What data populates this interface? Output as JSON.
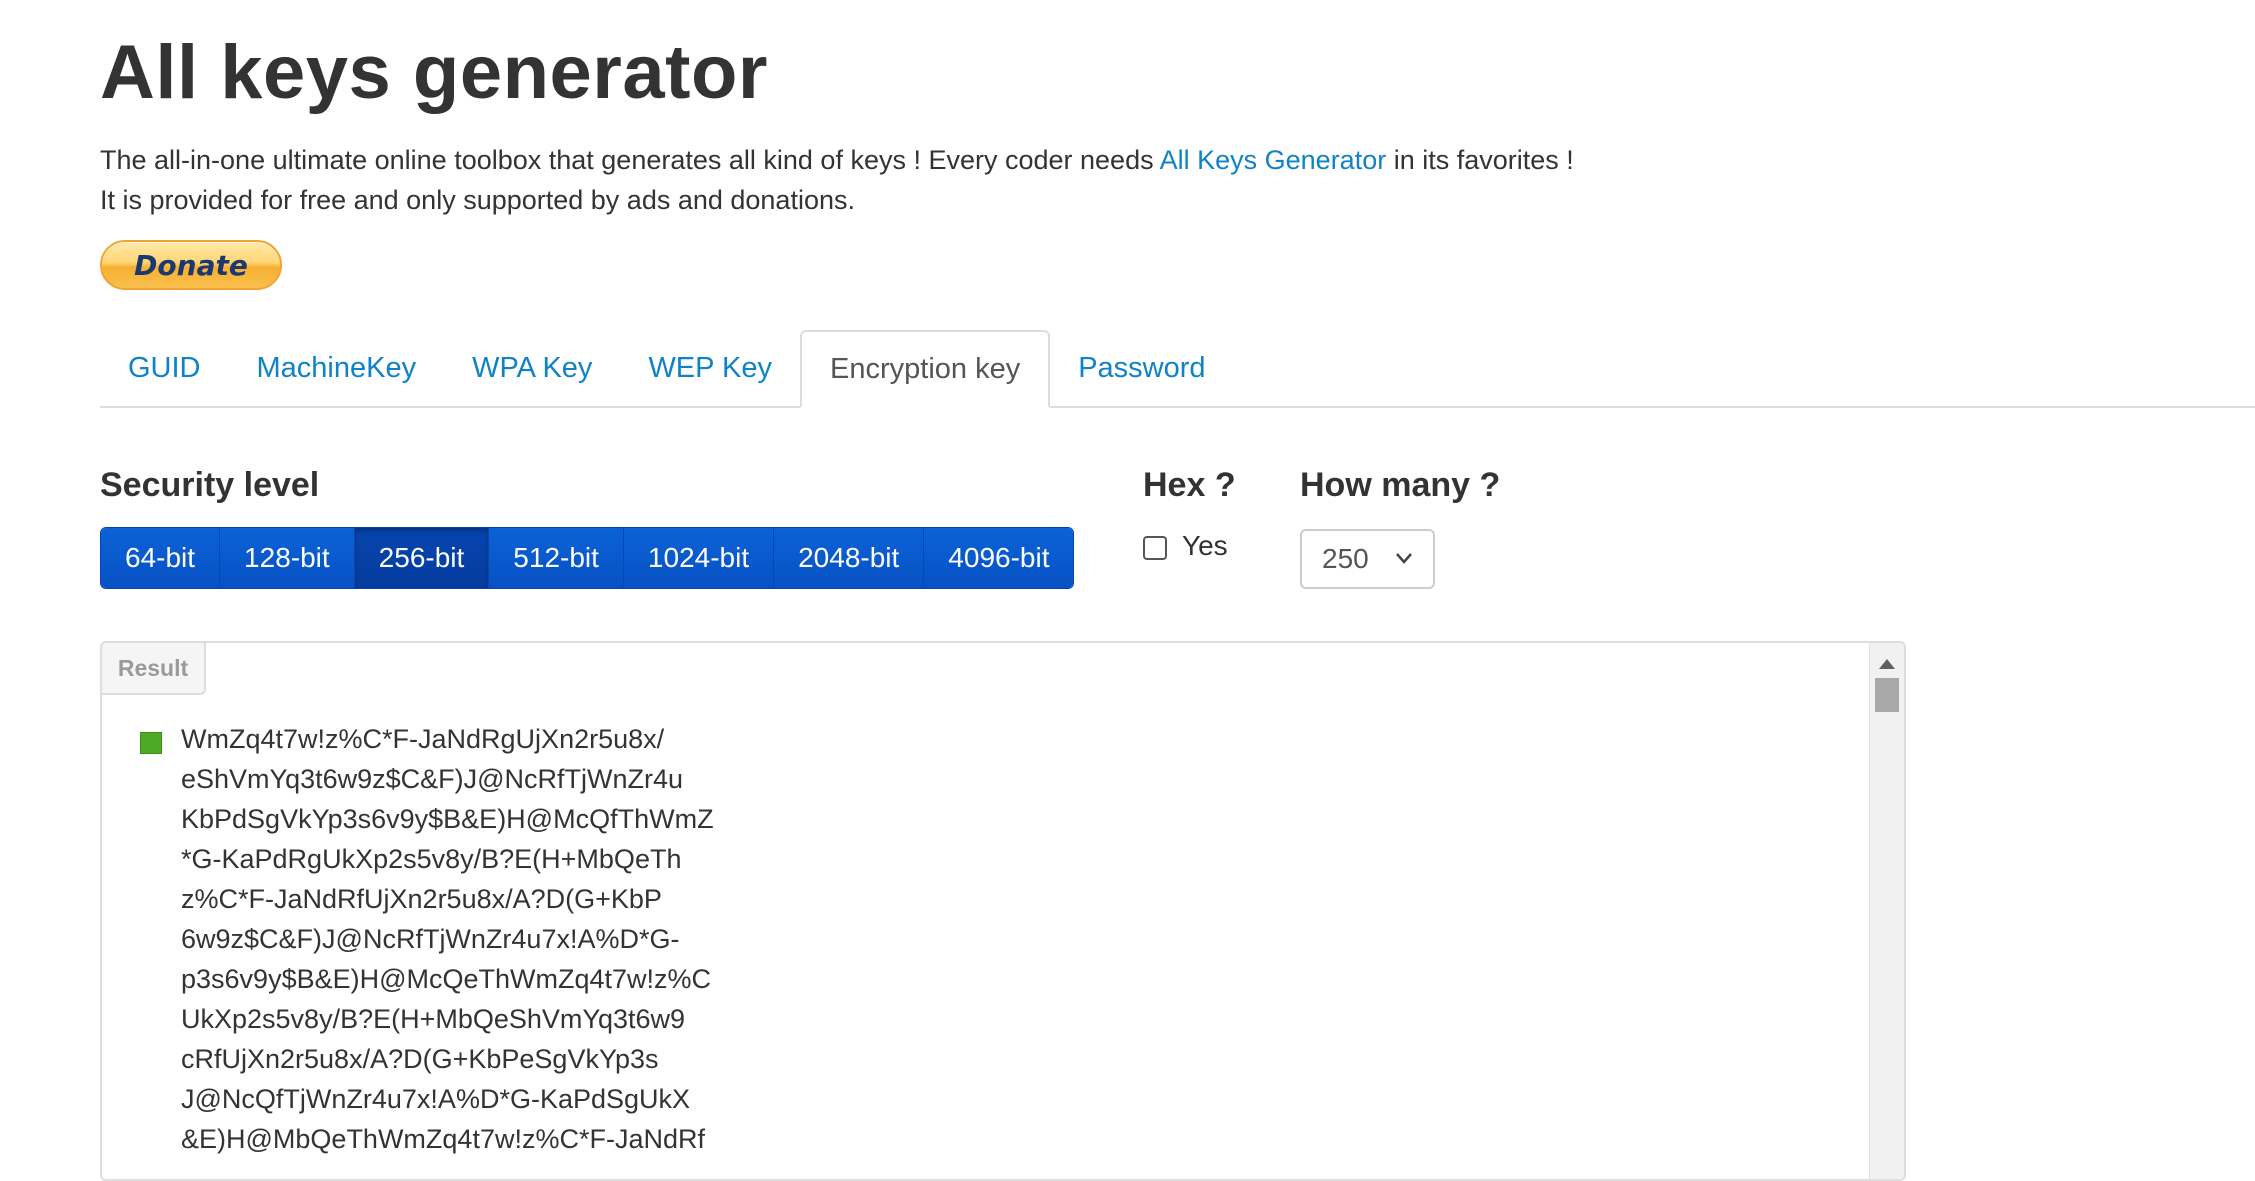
{
  "header": {
    "title": "All keys generator",
    "intro_before_link": "The all-in-one ultimate online toolbox that generates all kind of keys ! Every coder needs ",
    "intro_link": "All Keys Generator",
    "intro_after_link": " in its favorites !",
    "intro_line2": "It is provided for free and only supported by ads and donations.",
    "donate_label": "Donate"
  },
  "tabs": [
    {
      "label": "GUID",
      "active": false
    },
    {
      "label": "MachineKey",
      "active": false
    },
    {
      "label": "WPA Key",
      "active": false
    },
    {
      "label": "WEP Key",
      "active": false
    },
    {
      "label": "Encryption key",
      "active": true
    },
    {
      "label": "Password",
      "active": false
    }
  ],
  "security": {
    "label": "Security level",
    "options": [
      "64-bit",
      "128-bit",
      "256-bit",
      "512-bit",
      "1024-bit",
      "2048-bit",
      "4096-bit"
    ],
    "selected": "256-bit"
  },
  "hex": {
    "label": "Hex ?",
    "checkbox_label": "Yes",
    "checked": false
  },
  "how_many": {
    "label": "How many ?",
    "value": "250"
  },
  "result": {
    "tag": "Result",
    "bullet_color": "#4caa24",
    "key_lines": [
      "WmZq4t7w!z%C*F-JaNdRgUjXn2r5u8x/",
      "eShVmYq3t6w9z$C&F)J@NcRfTjWnZr4u",
      "KbPdSgVkYp3s6v9y$B&E)H@McQfThWmZ",
      "*G-KaPdRgUkXp2s5v8y/B?E(H+MbQeTh",
      "z%C*F-JaNdRfUjXn2r5u8x/A?D(G+KbP",
      "6w9z$C&F)J@NcRfTjWnZr4u7x!A%D*G-",
      "p3s6v9y$B&E)H@McQeThWmZq4t7w!z%C",
      "UkXp2s5v8y/B?E(H+MbQeShVmYq3t6w9",
      "cRfUjXn2r5u8x/A?D(G+KbPeSgVkYp3s",
      "J@NcQfTjWnZr4u7x!A%D*G-KaPdSgUkX",
      "&E)H@MbQeThWmZq4t7w!z%C*F-JaNdRf"
    ]
  },
  "colors": {
    "link": "#0f82c8",
    "button_blue": "#0751c4",
    "button_active": "#053c9e"
  }
}
